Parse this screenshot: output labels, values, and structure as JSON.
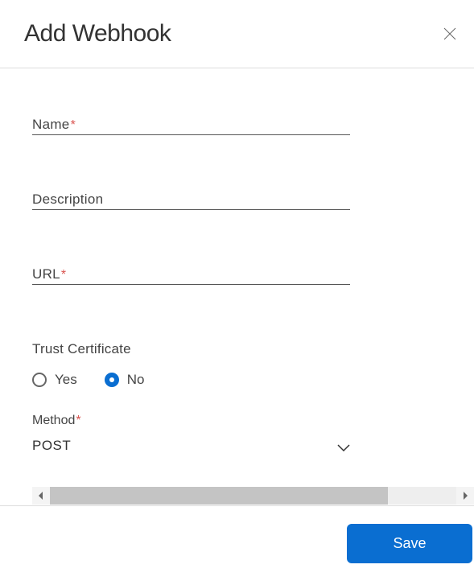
{
  "dialog": {
    "title": "Add Webhook"
  },
  "form": {
    "name": {
      "label": "Name",
      "required": true,
      "value": ""
    },
    "description": {
      "label": "Description",
      "required": false,
      "value": ""
    },
    "url": {
      "label": "URL",
      "required": true,
      "value": ""
    },
    "trustCertificate": {
      "label": "Trust Certificate",
      "options": [
        {
          "label": "Yes",
          "value": "yes",
          "selected": false
        },
        {
          "label": "No",
          "value": "no",
          "selected": true
        }
      ]
    },
    "method": {
      "label": "Method",
      "required": true,
      "value": "POST"
    }
  },
  "actions": {
    "save": "Save"
  },
  "requiredMark": "*"
}
